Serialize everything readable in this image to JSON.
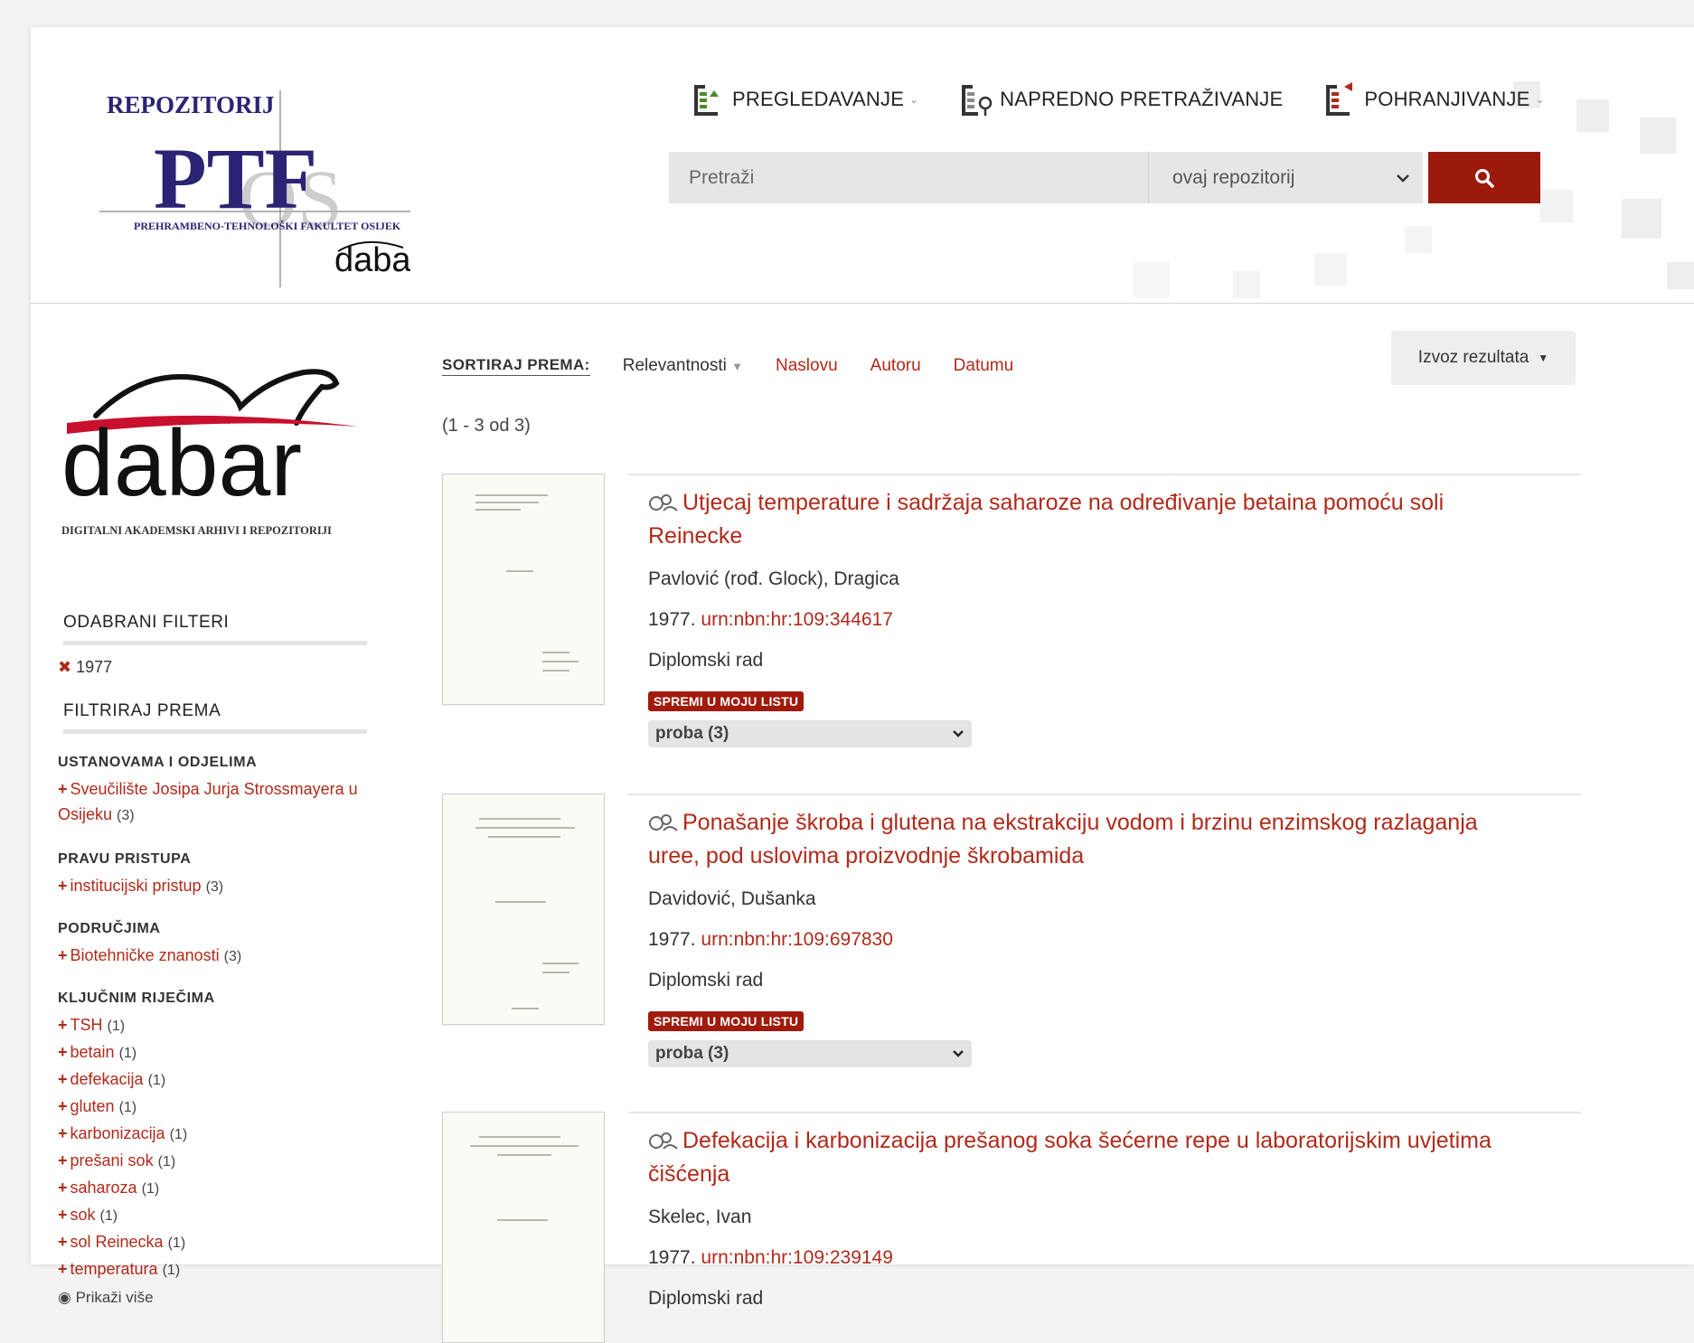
{
  "header": {
    "logo": {
      "top_text": "REPOZITORIJ",
      "main_text": "PTF",
      "overlay_text": "OS",
      "subtitle": "PREHRAMBENO-TEHNOLOŠKI FAKULTET OSIJEK",
      "brand": "dabar"
    },
    "nav": [
      {
        "label": "PREGLEDAVANJE",
        "has_dropdown": true,
        "icon": "browse-icon"
      },
      {
        "label": "NAPREDNO PRETRAŽIVANJE",
        "has_dropdown": false,
        "icon": "advanced-search-icon"
      },
      {
        "label": "POHRANJIVANJE",
        "has_dropdown": true,
        "icon": "deposit-icon"
      }
    ],
    "search": {
      "placeholder": "Pretraži",
      "scope_value": "ovaj repozitorij"
    }
  },
  "sidebar": {
    "logo": {
      "brand": "dabar",
      "tagline": "DIGITALNI AKADEMSKI ARHIVI I REPOZITORIJI"
    },
    "selected_filters_title": "ODABRANI FILTERI",
    "selected_filters": [
      "1977"
    ],
    "filter_by_title": "FILTRIRAJ PREMA",
    "groups": [
      {
        "title": "USTANOVAMA I ODJELIMA",
        "items": [
          {
            "label": "Sveučilište Josipa Jurja Strossmayera u Osijeku",
            "count": "(3)"
          }
        ]
      },
      {
        "title": "PRAVU PRISTUPA",
        "items": [
          {
            "label": "institucijski pristup",
            "count": "(3)"
          }
        ]
      },
      {
        "title": "PODRUČJIMA",
        "items": [
          {
            "label": "Biotehničke znanosti",
            "count": "(3)"
          }
        ]
      },
      {
        "title": "KLJUČNIM RIJEČIMA",
        "items": [
          {
            "label": "TSH",
            "count": "(1)"
          },
          {
            "label": "betain",
            "count": "(1)"
          },
          {
            "label": "defekacija",
            "count": "(1)"
          },
          {
            "label": "gluten",
            "count": "(1)"
          },
          {
            "label": "karbonizacija",
            "count": "(1)"
          },
          {
            "label": "prešani sok",
            "count": "(1)"
          },
          {
            "label": "saharoza",
            "count": "(1)"
          },
          {
            "label": "sok",
            "count": "(1)"
          },
          {
            "label": "sol Reinecka",
            "count": "(1)"
          },
          {
            "label": "temperatura",
            "count": "(1)"
          }
        ]
      }
    ],
    "show_more": "Prikaži više"
  },
  "main": {
    "sort_label": "SORTIRAJ PREMA:",
    "sort_active": "Relevantnosti",
    "sort_links": [
      "Naslovu",
      "Autoru",
      "Datumu"
    ],
    "export_label": "Izvoz rezultata",
    "result_range": "(1 - 3 od 3)",
    "save_label": "SPREMI U MOJU LISTU",
    "list_value": "proba (3)",
    "results": [
      {
        "title": "Utjecaj temperature i sadržaja saharoze na određivanje betaina pomoću soli Reinecke",
        "author": "Pavlović (rođ. Glock), Dragica",
        "year": "1977.",
        "urn": "urn:nbn:hr:109:344617",
        "type": "Diplomski rad"
      },
      {
        "title": "Ponašanje škroba i glutena na ekstrakciju vodom i brzinu enzimskog razlaganja uree, pod uslovima proizvodnje škrobamida",
        "author": "Davidović, Dušanka",
        "year": "1977.",
        "urn": "urn:nbn:hr:109:697830",
        "type": "Diplomski rad"
      },
      {
        "title": "Defekacija i karbonizacija prešanog soka šećerne repe u laboratorijskim uvjetima čišćenja",
        "author": "Skelec, Ivan",
        "year": "1977.",
        "urn": "urn:nbn:hr:109:239149",
        "type": "Diplomski rad"
      }
    ]
  },
  "colors": {
    "accent": "#b02a1a",
    "button_red": "#9b1a0c",
    "logo_blue": "#2b2474"
  }
}
